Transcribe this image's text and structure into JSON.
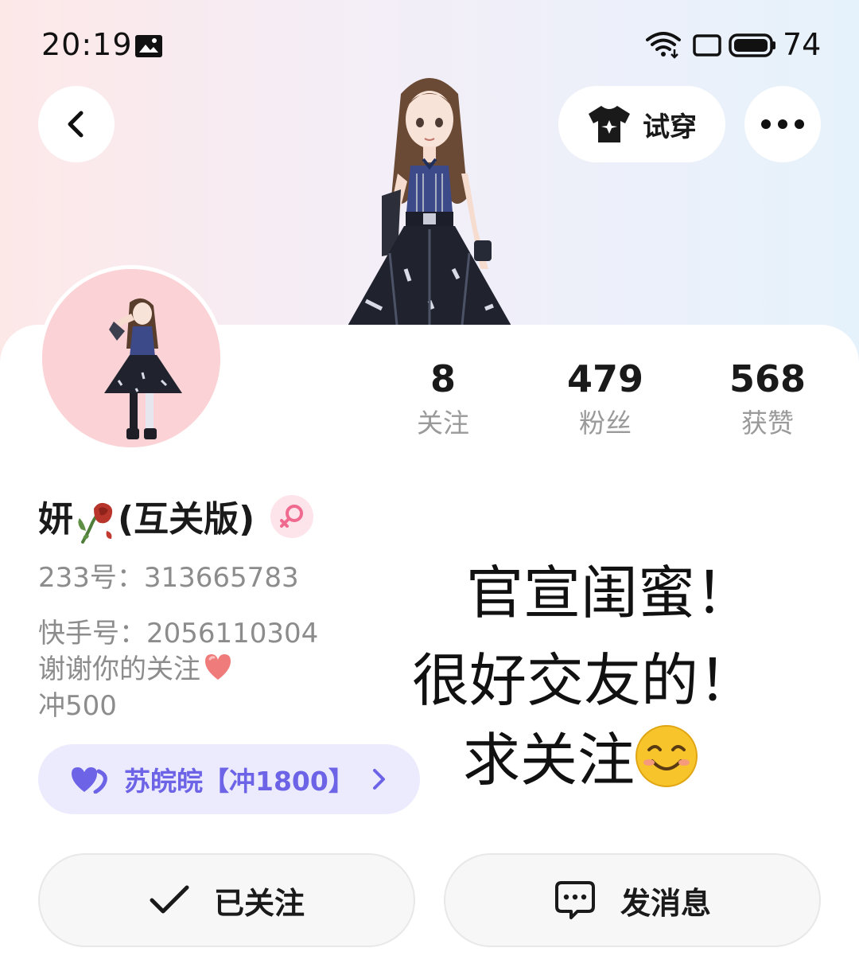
{
  "status_bar": {
    "time": "20:19",
    "battery": "74"
  },
  "header": {
    "tryon_label": "试穿"
  },
  "stats": [
    {
      "value": "8",
      "label": "关注"
    },
    {
      "value": "479",
      "label": "粉丝"
    },
    {
      "value": "568",
      "label": "获赞"
    }
  ],
  "profile": {
    "name_prefix": "妍",
    "name_suffix": "(互关版)",
    "id_233": "233号：313665783",
    "id_kuaishou": "快手号：2056110304",
    "bio_line1": "谢谢你的关注",
    "bio_line2": "冲500"
  },
  "guard": {
    "label": "苏皖皖【冲1800】"
  },
  "announcement": {
    "line1": "官宣闺蜜！",
    "line2": "很好交友的！",
    "line3": "求关注"
  },
  "actions": {
    "follow_label": "已关注",
    "message_label": "发消息"
  },
  "colors": {
    "accent_purple": "#6c63e6",
    "pill_bg": "#ecebfd",
    "gender_pink": "#f06a8f"
  }
}
